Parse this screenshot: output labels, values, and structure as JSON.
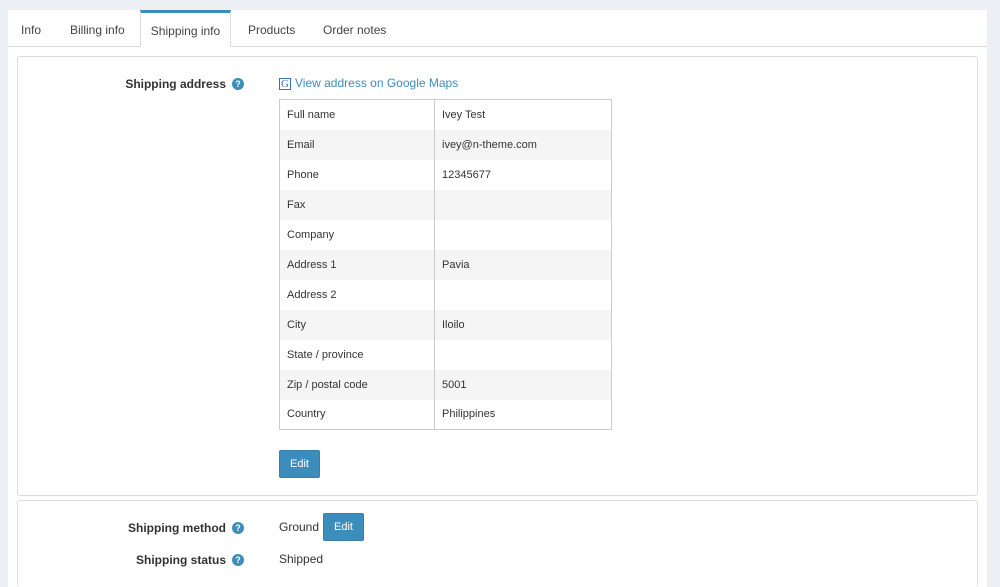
{
  "tabs": [
    {
      "label": "Info"
    },
    {
      "label": "Billing info"
    },
    {
      "label": "Shipping info"
    },
    {
      "label": "Products"
    },
    {
      "label": "Order notes"
    }
  ],
  "active_tab": "Shipping info",
  "shipping_address": {
    "label": "Shipping address",
    "map_link": "View address on Google Maps",
    "rows": [
      {
        "key": "Full name",
        "value": "Ivey Test"
      },
      {
        "key": "Email",
        "value": "ivey@n-theme.com"
      },
      {
        "key": "Phone",
        "value": "12345677"
      },
      {
        "key": "Fax",
        "value": ""
      },
      {
        "key": "Company",
        "value": ""
      },
      {
        "key": "Address 1",
        "value": "Pavia"
      },
      {
        "key": "Address 2",
        "value": ""
      },
      {
        "key": "City",
        "value": "Iloilo"
      },
      {
        "key": "State / province",
        "value": ""
      },
      {
        "key": "Zip / postal code",
        "value": "5001"
      },
      {
        "key": "Country",
        "value": "Philippines"
      }
    ],
    "edit_label": "Edit"
  },
  "shipping_method": {
    "label": "Shipping method",
    "value": "Ground",
    "edit_label": "Edit"
  },
  "shipping_status": {
    "label": "Shipping status",
    "value": "Shipped"
  },
  "help_glyph": "?",
  "google_glyph": "G",
  "colors": {
    "accent": "#3c8dbc",
    "background": "#ecf0f5"
  }
}
